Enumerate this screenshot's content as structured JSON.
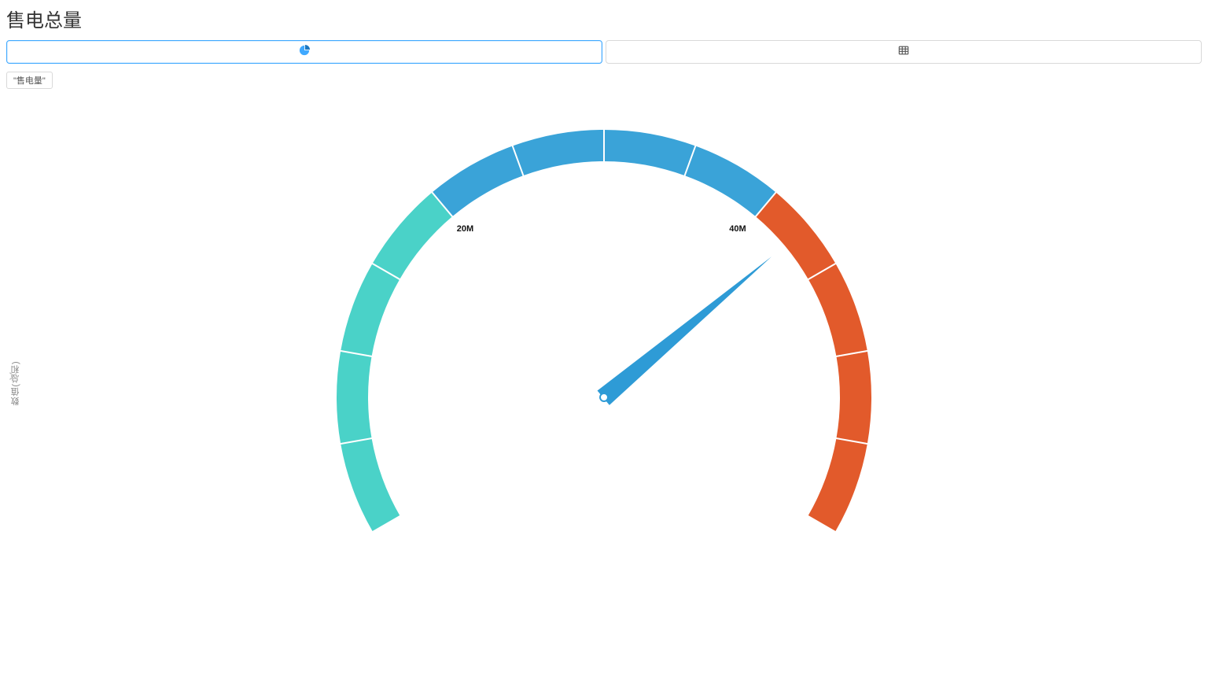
{
  "header": {
    "title": "售电总量"
  },
  "tabs": {
    "chart_tab_icon": "pie-chart-icon",
    "table_tab_icon": "table-icon",
    "active": "chart"
  },
  "legend": {
    "series_label": "\"售电量\""
  },
  "axis": {
    "ylabel": "数值(总和)"
  },
  "chart_data": {
    "type": "gauge",
    "title": "售电总量",
    "series_name": "售电量",
    "unit": "",
    "min": 0,
    "max": 60000000,
    "value": 42500000,
    "tick_labels": {
      "20M": 20000000,
      "40M": 40000000
    },
    "segments": [
      {
        "from": 0,
        "to": 20000000,
        "color": "#4ad2c8"
      },
      {
        "from": 20000000,
        "to": 40000000,
        "color": "#3aa3d8"
      },
      {
        "from": 40000000,
        "to": 60000000,
        "color": "#e25a2b"
      }
    ],
    "needle_color": "#2e9bd6",
    "start_angle_deg": 210,
    "end_angle_deg": -30,
    "minor_ticks_per_segment": 4,
    "ylabel": "数值(总和)"
  }
}
